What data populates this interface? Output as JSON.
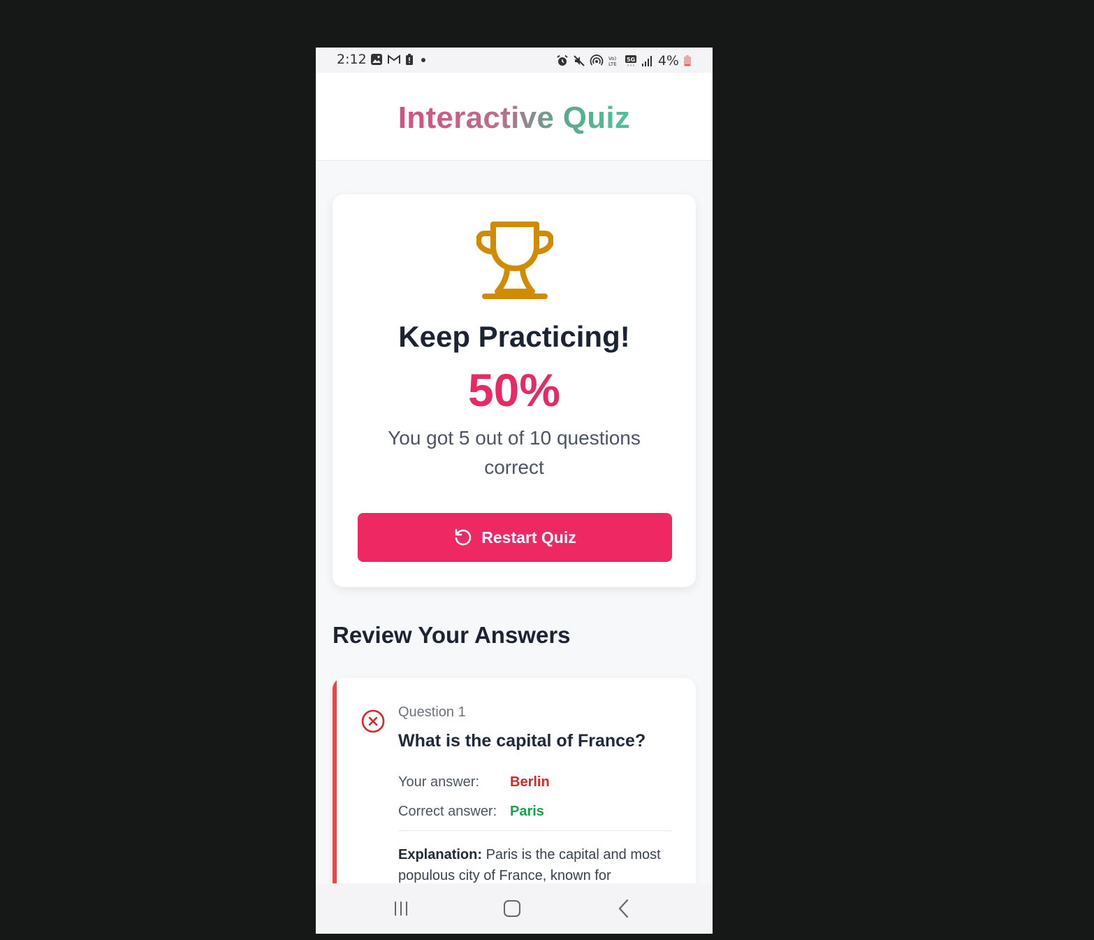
{
  "status_bar": {
    "time": "2:12",
    "battery": "4%",
    "left_icons": [
      "gallery-icon",
      "gmail-icon",
      "battery-alert-icon",
      "dot-icon"
    ],
    "right_icons": [
      "alarm-icon",
      "mute-icon",
      "hotspot-icon",
      "volte-icon",
      "5g-icon",
      "signal-icon",
      "battery-icon"
    ]
  },
  "header": {
    "title": "Interactive Quiz"
  },
  "result": {
    "icon": "trophy-icon",
    "headline": "Keep Practicing!",
    "score": "50%",
    "summary": "You got 5 out of 10 questions correct",
    "restart_label": "Restart Quiz"
  },
  "review": {
    "heading": "Review Your Answers",
    "items": [
      {
        "number": "Question 1",
        "question": "What is the capital of France?",
        "your_answer_label": "Your answer:",
        "your_answer": "Berlin",
        "correct_answer_label": "Correct answer:",
        "correct_answer": "Paris",
        "explanation_label": "Explanation:",
        "explanation": "Paris is the capital and most populous city of France, known for"
      }
    ]
  },
  "colors": {
    "accent": "#ed2862",
    "score": "#e82a63",
    "trophy": "#d18b00",
    "incorrect": "#dc2626",
    "correct": "#16a34a"
  }
}
